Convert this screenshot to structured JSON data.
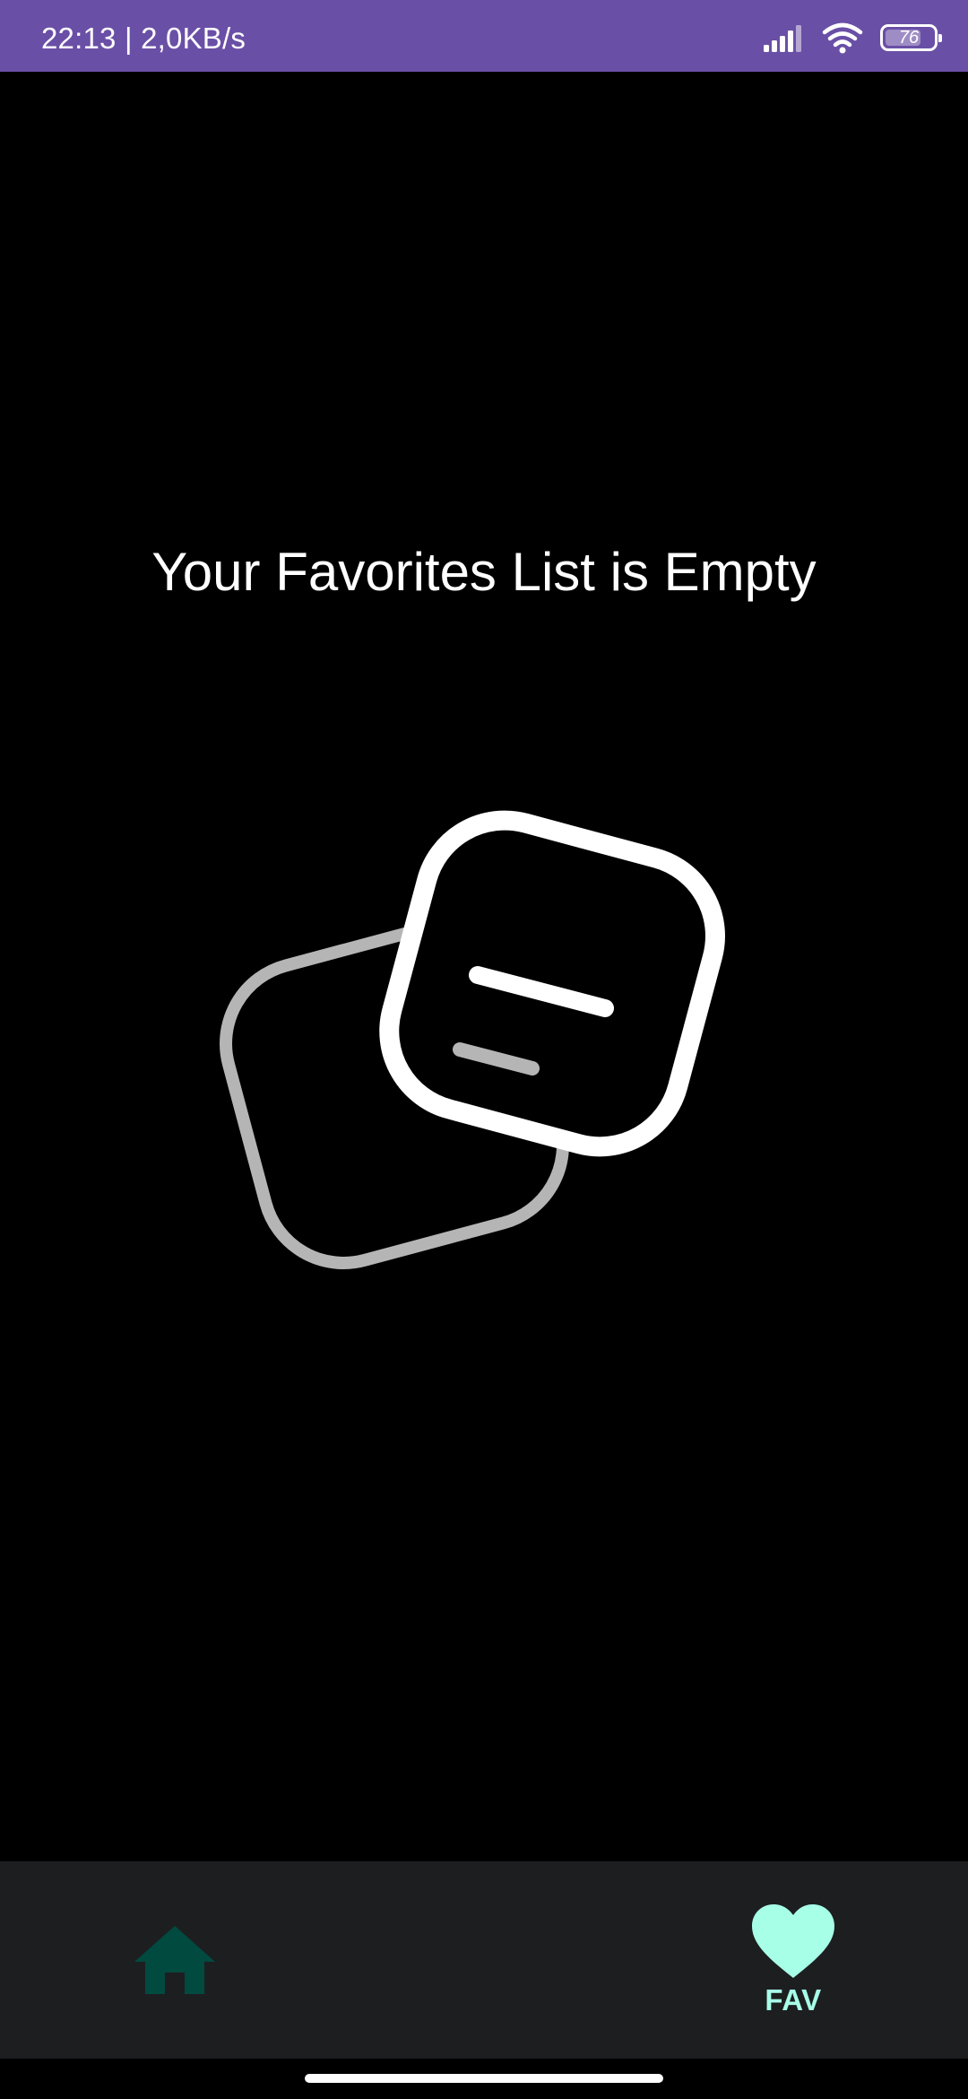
{
  "status_bar": {
    "time_and_speed": "22:13 | 2,0KB/s",
    "battery_level": "76",
    "icons": [
      "signal-icon",
      "wifi-icon",
      "battery-icon"
    ],
    "background_color": "#6a4fa6"
  },
  "empty_state": {
    "title": "Your Favorites List is Empty",
    "illustration": "empty-cards-illustration"
  },
  "bottom_nav": {
    "items": [
      {
        "icon": "home-icon",
        "label": "",
        "active": false,
        "color": "#014a40"
      },
      {
        "icon": "heart-icon",
        "label": "FAV",
        "active": true,
        "color": "#a7ffe8"
      }
    ],
    "background_color": "#1d1e20"
  }
}
